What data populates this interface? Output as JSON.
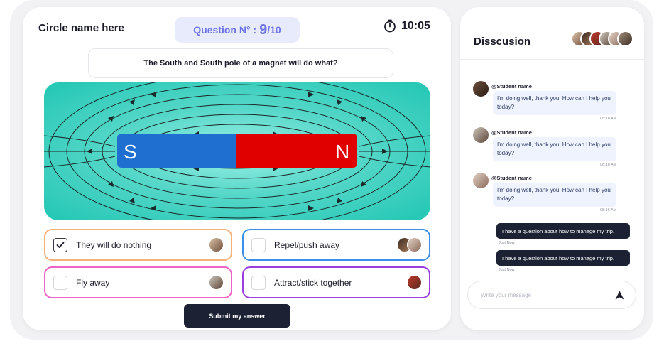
{
  "header": {
    "circle_name": "Circle name here",
    "question_label": "Question N° : ",
    "question_number": "9",
    "question_total": "/10",
    "timer": "10:05"
  },
  "question": {
    "text": "The South and South pole of a magnet will do what?"
  },
  "illustration": {
    "south_label": "S",
    "north_label": "N",
    "colors": {
      "south": "#1f6fd1",
      "north": "#e00000",
      "background": "#22c6b4"
    }
  },
  "options": [
    {
      "label": "They will do nothing",
      "checked": true,
      "accent": "#f4b27a"
    },
    {
      "label": "Repel/push away",
      "checked": false,
      "accent": "#3a8fe8"
    },
    {
      "label": "Fly away",
      "checked": false,
      "accent": "#ef63c4"
    },
    {
      "label": "Attract/stick together",
      "checked": false,
      "accent": "#9b3ee0"
    }
  ],
  "submit_label": "Submit my answer",
  "chat": {
    "title": "Disscusion",
    "messages": [
      {
        "name": "@Student name",
        "text": "I'm doing well, thank you! How can I help you today?",
        "time": "08:16 AM"
      },
      {
        "name": "@Student name",
        "text": "I'm doing well, thank you! How can I help you today?",
        "time": "08:16 AM"
      },
      {
        "name": "@Student name",
        "text": "I'm doing well, thank you! How can I help you today?",
        "time": "08:16 AM"
      }
    ],
    "outgoing": [
      {
        "text": "I have a question about how to manage my trip.",
        "time": "Just Now"
      },
      {
        "text": "I have a question about how to manage my trip.",
        "time": "Just Now"
      }
    ],
    "input_placeholder": "Write your message"
  },
  "icons": [
    "stopwatch-icon",
    "check-icon",
    "send-icon",
    "avatar"
  ]
}
